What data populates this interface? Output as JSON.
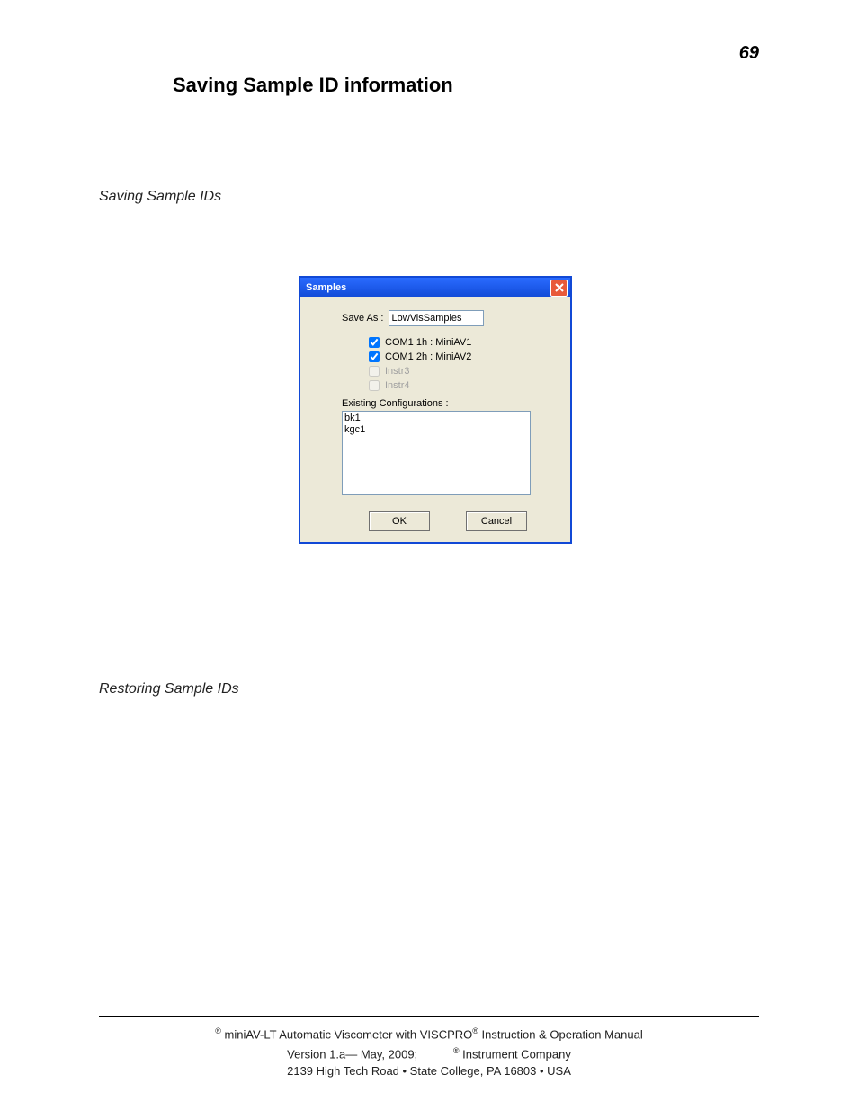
{
  "page": {
    "number": "69",
    "heading": "Saving Sample ID information",
    "sub1": "Saving Sample IDs",
    "sub2": "Restoring Sample IDs"
  },
  "dialog": {
    "title": "Samples",
    "save_as_label": "Save As :",
    "save_as_value": "LowVisSamples",
    "checkboxes": [
      {
        "label": "COM1 1h : MiniAV1",
        "checked": true,
        "enabled": true
      },
      {
        "label": "COM1 2h : MiniAV2",
        "checked": true,
        "enabled": true
      },
      {
        "label": "Instr3",
        "checked": false,
        "enabled": false
      },
      {
        "label": "Instr4",
        "checked": false,
        "enabled": false
      }
    ],
    "existing_label": "Existing Configurations :",
    "existing_items": [
      "bk1",
      "kgc1"
    ],
    "ok_label": "OK",
    "cancel_label": "Cancel"
  },
  "footer": {
    "line1a": " miniAV-LT Automatic Viscometer with VISCPRO",
    "line1b": " Instruction & Operation Manual",
    "line2a": "Version 1.a— May, 2009;",
    "line2b": " Instrument Company",
    "line3": "2139 High Tech Road • State College, PA  16803 • USA"
  }
}
